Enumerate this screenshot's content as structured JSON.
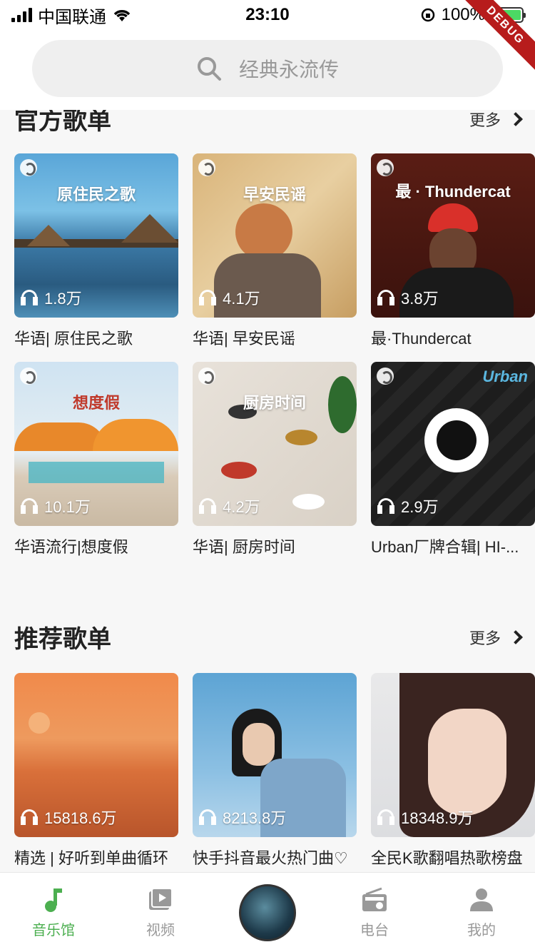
{
  "status_bar": {
    "carrier": "中国联通",
    "time": "23:10",
    "battery": "100%",
    "debug_label": "DEBUG"
  },
  "search": {
    "placeholder": "经典永流传"
  },
  "official": {
    "title": "官方歌单",
    "more": "更多",
    "items": [
      {
        "cover_title": "原住民之歌",
        "plays": "1.8万",
        "caption": "华语| 原住民之歌"
      },
      {
        "cover_title": "早安民谣",
        "plays": "4.1万",
        "caption": "华语| 早安民谣"
      },
      {
        "cover_title": "最 · Thundercat",
        "plays": "3.8万",
        "caption": "最·Thundercat"
      },
      {
        "cover_title": "想度假",
        "plays": "10.1万",
        "caption": "华语流行|想度假"
      },
      {
        "cover_title": "厨房时间",
        "plays": "4.2万",
        "caption": "华语| 厨房时间"
      },
      {
        "cover_title": "Urban",
        "plays": "2.9万",
        "caption": "Urban厂牌合辑| HI-..."
      }
    ]
  },
  "recommend": {
    "title": "推荐歌单",
    "more": "更多",
    "items": [
      {
        "plays": "15818.6万",
        "caption": "精选 | 好听到单曲循环"
      },
      {
        "plays": "8213.8万",
        "caption": "快手抖音最火热门曲♡"
      },
      {
        "plays": "18348.9万",
        "caption": "全民K歌翻唱热歌榜盘"
      }
    ]
  },
  "tabbar": {
    "items": [
      {
        "label": "音乐馆",
        "active": true
      },
      {
        "label": "视频",
        "active": false
      },
      {
        "label": "",
        "active": false
      },
      {
        "label": "电台",
        "active": false
      },
      {
        "label": "我的",
        "active": false
      }
    ]
  },
  "colors": {
    "accent": "#4caf50",
    "background": "#f7f7f7"
  }
}
